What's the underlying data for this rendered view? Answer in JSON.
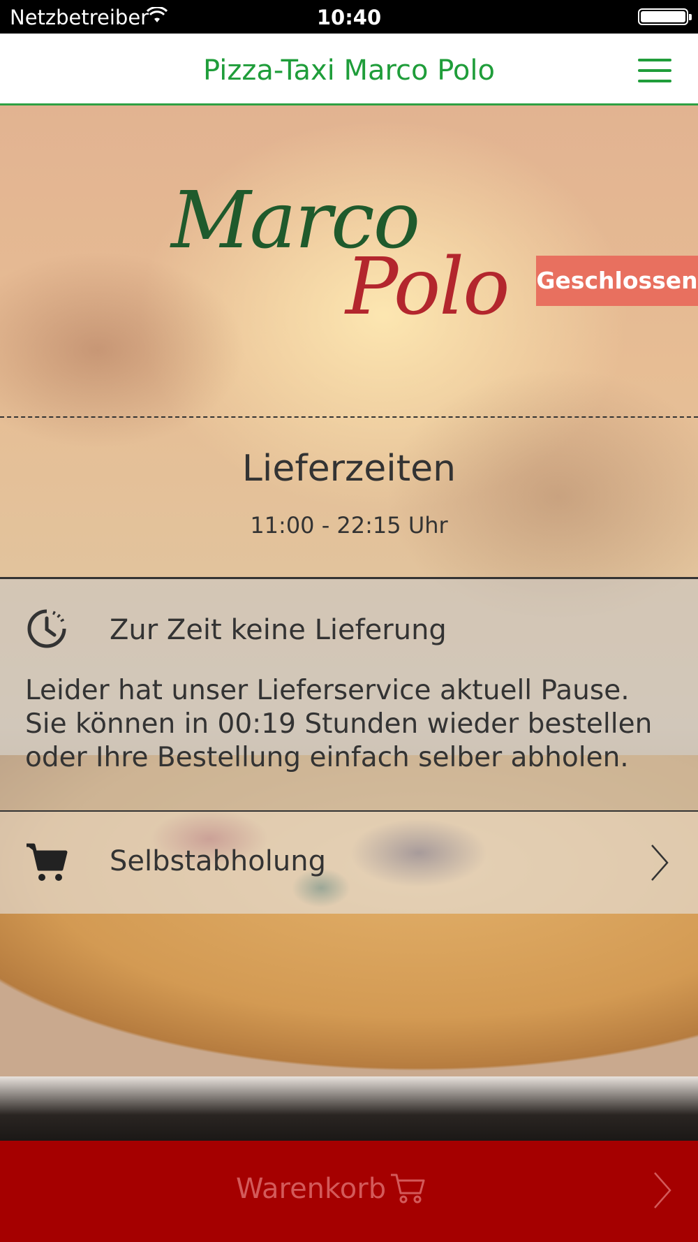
{
  "status_bar": {
    "carrier": "Netzbetreiber",
    "time": "10:40",
    "battery_level": 1.0
  },
  "nav": {
    "title": "Pizza-Taxi Marco Polo",
    "menu_icon": "hamburger-menu-icon"
  },
  "logo": {
    "line1": "Marco",
    "line2": "Polo",
    "colors": {
      "green": "#1f5a2c",
      "red": "#b3262d"
    }
  },
  "status_badge": {
    "label": "Geschlossen",
    "color": "#e8705f"
  },
  "hours": {
    "title": "Lieferzeiten",
    "value": "11:00 - 22:15 Uhr"
  },
  "delivery": {
    "icon": "clock-icon",
    "heading": "Zur Zeit keine Lieferung",
    "text": "Leider hat unser Lieferservice aktuell Pause. Sie können in 00:19 Stunden wieder bestellen oder Ihre Bestellung einfach selber abholen."
  },
  "pickup": {
    "icon": "shopping-cart-icon",
    "label": "Selbstabholung",
    "chevron": "chevron-right-icon"
  },
  "cart_bar": {
    "label": "Warenkorb",
    "icon": "shopping-cart-icon",
    "chevron": "chevron-right-icon",
    "background": "#a50000"
  },
  "accent_color": "#1f9d3a"
}
